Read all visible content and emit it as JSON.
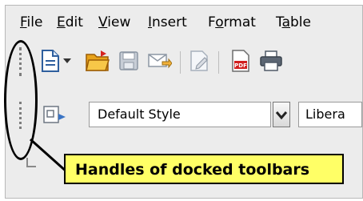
{
  "menu": [
    {
      "mnemonic": "F",
      "rest": "ile"
    },
    {
      "mnemonic": "E",
      "rest": "dit"
    },
    {
      "mnemonic": "V",
      "rest": "iew"
    },
    {
      "mnemonic": "I",
      "rest": "nsert"
    },
    {
      "pre": "F",
      "mnemonic": "o",
      "rest": "rmat"
    },
    {
      "pre": "T",
      "mnemonic": "a",
      "rest": "ble"
    }
  ],
  "toolbar_icons": [
    "new-document-icon",
    "dropdown-arrow-icon",
    "open-folder-icon",
    "save-icon",
    "email-icon",
    "edit-file-icon",
    "export-pdf-icon",
    "print-icon"
  ],
  "formatting": {
    "styles_icon": "styles-icon",
    "paragraph_style": "Default Style",
    "font_name": "Libera"
  },
  "callout": {
    "text": "Handles of docked toolbars"
  },
  "colors": {
    "callout_bg": "#ffff66",
    "toolbar_bg": "#ececec"
  }
}
